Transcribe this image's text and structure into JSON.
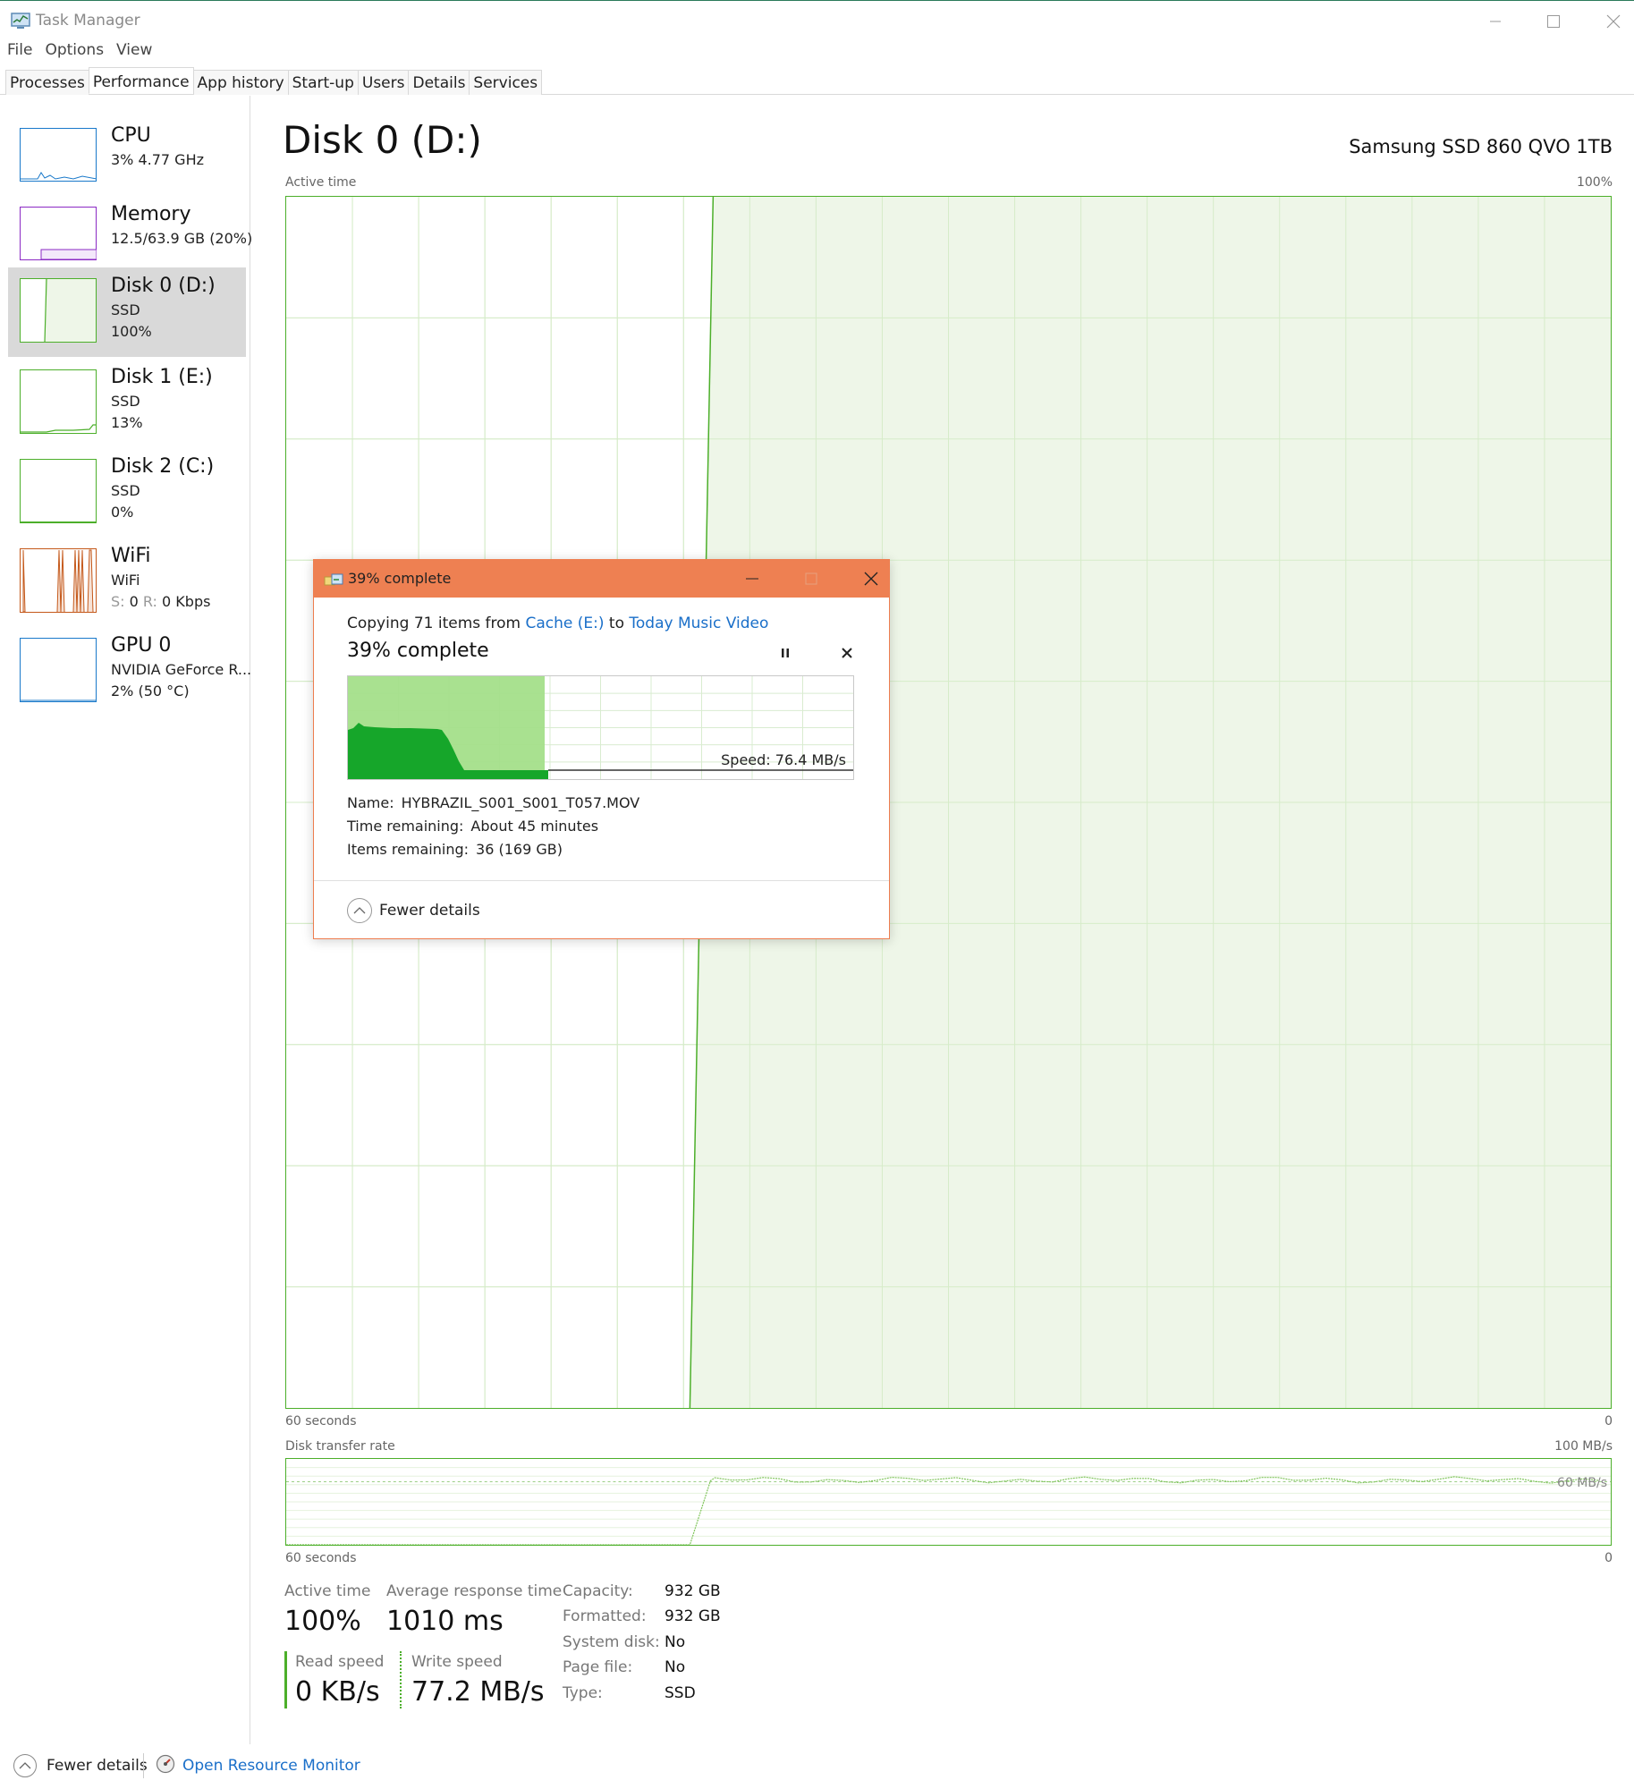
{
  "window": {
    "title": "Task Manager"
  },
  "menu": [
    "File",
    "Options",
    "View"
  ],
  "tabs": [
    "Processes",
    "Performance",
    "App history",
    "Start-up",
    "Users",
    "Details",
    "Services"
  ],
  "active_tab": "Performance",
  "sidebar": {
    "items": [
      {
        "title": "CPU",
        "sub1": "3% 4.77 GHz",
        "color": "#1979ca"
      },
      {
        "title": "Memory",
        "sub1": "12.5/63.9 GB (20%)",
        "color": "#8b2ac4"
      },
      {
        "title": "Disk 0 (D:)",
        "sub1": "SSD",
        "sub2": "100%",
        "color": "#4caf2a",
        "selected": true
      },
      {
        "title": "Disk 1 (E:)",
        "sub1": "SSD",
        "sub2": "13%",
        "color": "#4caf2a"
      },
      {
        "title": "Disk 2 (C:)",
        "sub1": "SSD",
        "sub2": "0%",
        "color": "#4caf2a"
      },
      {
        "title": "WiFi",
        "sub1": "WiFi",
        "s_label": "S:",
        "s_value": "0",
        "r_label": "R:",
        "r_value": "0 Kbps",
        "color": "#c4581a"
      },
      {
        "title": "GPU 0",
        "sub1": "NVIDIA GeForce R...",
        "sub2": "2% (50 °C)",
        "color": "#1979ca"
      }
    ]
  },
  "main": {
    "title": "Disk 0 (D:)",
    "model": "Samsung SSD 860 QVO 1TB",
    "active_chart": {
      "label": "Active time",
      "max_label": "100%",
      "left_label": "60 seconds",
      "right_label": "0"
    },
    "transfer_chart": {
      "label": "Disk transfer rate",
      "max_label": "100 MB/s",
      "ref_label": "60 MB/s",
      "left_label": "60 seconds",
      "right_label": "0"
    }
  },
  "stats": {
    "active_time_label": "Active time",
    "active_time_value": "100%",
    "avg_response_label": "Average response time",
    "avg_response_value": "1010 ms",
    "read_speed_label": "Read speed",
    "read_speed_value": "0 KB/s",
    "write_speed_label": "Write speed",
    "write_speed_value": "77.2 MB/s"
  },
  "properties": [
    {
      "label": "Capacity:",
      "value": "932 GB"
    },
    {
      "label": "Formatted:",
      "value": "932 GB"
    },
    {
      "label": "System disk:",
      "value": "No"
    },
    {
      "label": "Page file:",
      "value": "No"
    },
    {
      "label": "Type:",
      "value": "SSD"
    }
  ],
  "footer": {
    "fewer_details": "Fewer details",
    "open_resource_monitor": "Open Resource Monitor"
  },
  "copy_dialog": {
    "title": "39% complete",
    "copying_prefix": "Copying 71 items from",
    "source": "Cache (E:)",
    "to_word": "to",
    "destination": "Today Music Video",
    "progress_text": "39% complete",
    "progress": 0.39,
    "speed": "Speed: 76.4 MB/s",
    "name_label": "Name:",
    "name_value": "HYBRAZIL_S001_S001_T057.MOV",
    "time_label": "Time remaining:",
    "time_value": "About 45 minutes",
    "items_label": "Items remaining:",
    "items_value": "36 (169 GB)",
    "fewer_details": "Fewer details",
    "accent": "#ee8052"
  },
  "colors": {
    "disk": "#4caf2a",
    "disk_fill": "#eef6e8",
    "grid": "#d6ecc9",
    "link": "#1a6fc9"
  }
}
